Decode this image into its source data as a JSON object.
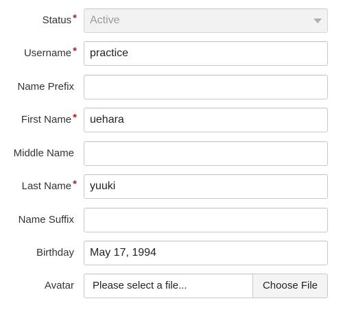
{
  "form": {
    "status": {
      "label": "Status",
      "required": "*",
      "value": "Active"
    },
    "username": {
      "label": "Username",
      "required": "*",
      "value": "practice"
    },
    "name_prefix": {
      "label": "Name Prefix",
      "value": ""
    },
    "first_name": {
      "label": "First Name",
      "required": "*",
      "value": "uehara"
    },
    "middle_name": {
      "label": "Middle Name",
      "value": ""
    },
    "last_name": {
      "label": "Last Name",
      "required": "*",
      "value": "yuuki"
    },
    "name_suffix": {
      "label": "Name Suffix",
      "value": ""
    },
    "birthday": {
      "label": "Birthday",
      "value": "May 17, 1994"
    },
    "avatar": {
      "label": "Avatar",
      "placeholder": "Please select a file...",
      "button_label": "Choose File"
    }
  },
  "colors": {
    "required_marker": "#b71c1c",
    "border": "#c8c8c8",
    "disabled_bg": "#f2f2f2"
  }
}
